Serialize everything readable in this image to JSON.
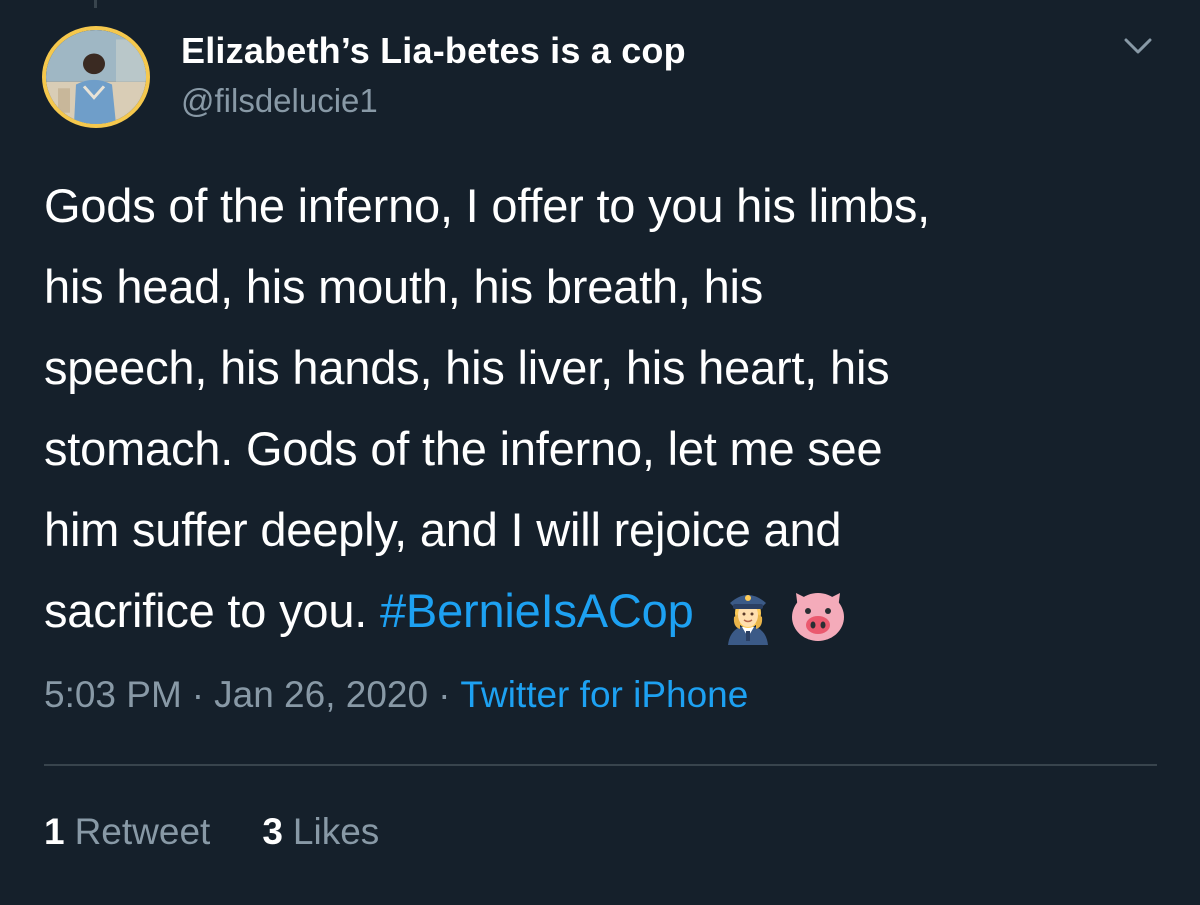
{
  "user": {
    "display_name": "Elizabeth’s Lia-betes is a cop",
    "handle": "@filsdelucie1",
    "avatar_icon": "profile-photo",
    "avatar_ring_color": "#f5c84d"
  },
  "menu": {
    "icon": "chevron-down-icon"
  },
  "tweet": {
    "lines": [
      "Gods of the inferno, I offer to you his limbs,",
      "his head, his mouth, his breath, his",
      "speech, his hands, his liver, his heart, his",
      "stomach. Gods of the inferno, let me see",
      "him suffer deeply, and I will rejoice and"
    ],
    "last_line_text": "sacrifice to you. ",
    "hashtag": "#BernieIsACop",
    "emojis": [
      "woman-police-officer-emoji",
      "pig-face-emoji"
    ]
  },
  "meta": {
    "time": "5:03 PM",
    "separator": "·",
    "date": "Jan 26, 2020",
    "source": "Twitter for iPhone"
  },
  "stats": {
    "retweets_count": "1",
    "retweets_label": "Retweet",
    "likes_count": "3",
    "likes_label": "Likes"
  },
  "colors": {
    "background": "#15202b",
    "text": "#ffffff",
    "secondary_text": "#8899a6",
    "link": "#1da1f2",
    "divider": "#38444d"
  }
}
